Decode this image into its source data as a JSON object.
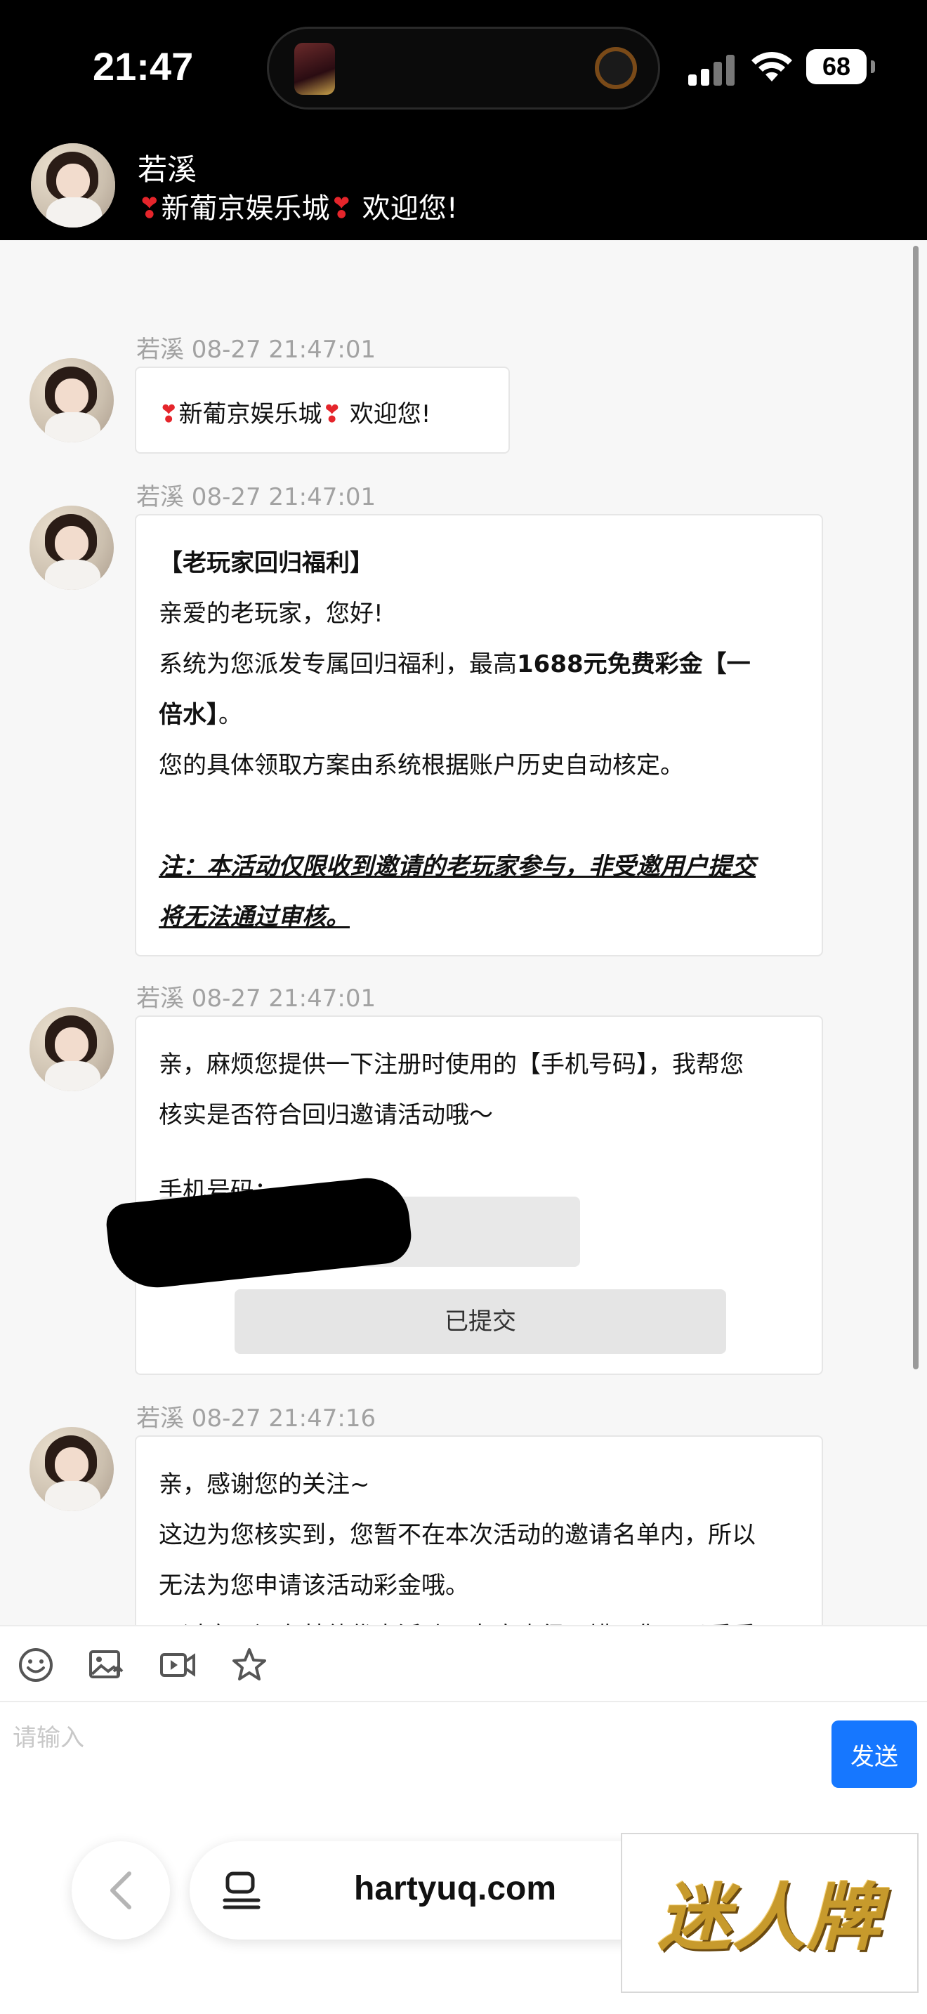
{
  "status_bar": {
    "time": "21:47",
    "battery": "68"
  },
  "header": {
    "name": "若溪",
    "subtitle_left": "新葡京娱乐城",
    "subtitle_right": "欢迎您!",
    "heart": "❣"
  },
  "messages": [
    {
      "meta": "若溪  08-27 21:47:01",
      "heart": "❣",
      "text_a": "新葡京娱乐城",
      "text_b": "欢迎您!"
    },
    {
      "meta": "若溪  08-27 21:47:01",
      "title": "【老玩家回归福利】",
      "greeting": "亲爱的老玩家，您好!",
      "line3_pre": "系统为您派发专属回归福利，最高",
      "line3_bold": "1688元免费彩金【一",
      "line4_bold": "倍水】",
      "line4_post": "。",
      "line5": "您的具体领取方案由系统根据账户历史自动核定。",
      "note1": "注：本活动仅限收到邀请的老玩家参与，非受邀用户提交",
      "note2": "将无法通过审核。"
    },
    {
      "meta": "若溪  08-27 21:47:01",
      "line1": "亲，麻烦您提供一下注册时使用的【手机号码】，我帮您",
      "line2": "核实是否符合回归邀请活动哦～",
      "phone_label": "手机号码：",
      "submitted": "已提交"
    },
    {
      "meta": "若溪  08-27 21:47:16",
      "line1": "亲，感谢您的关注~",
      "line2": "这边为您核实到，您暂不在本次活动的邀请名单内，所以",
      "line3": "无法为您申请该活动彩金哦。",
      "line4": "不过官网还有其他优惠活动，力度也很不错，您可以看看"
    }
  ],
  "toolbar": {
    "icons": [
      "emoji-icon",
      "image-icon",
      "video-icon",
      "star-icon"
    ]
  },
  "composer": {
    "placeholder": "请输入",
    "send_label": "发送"
  },
  "browser": {
    "url": "hartyuq.com"
  },
  "ad": {
    "text": "迷人牌"
  },
  "colors": {
    "accent": "#1677ff",
    "heart": "#e5252b",
    "ad_gold": "#c79a2c"
  }
}
